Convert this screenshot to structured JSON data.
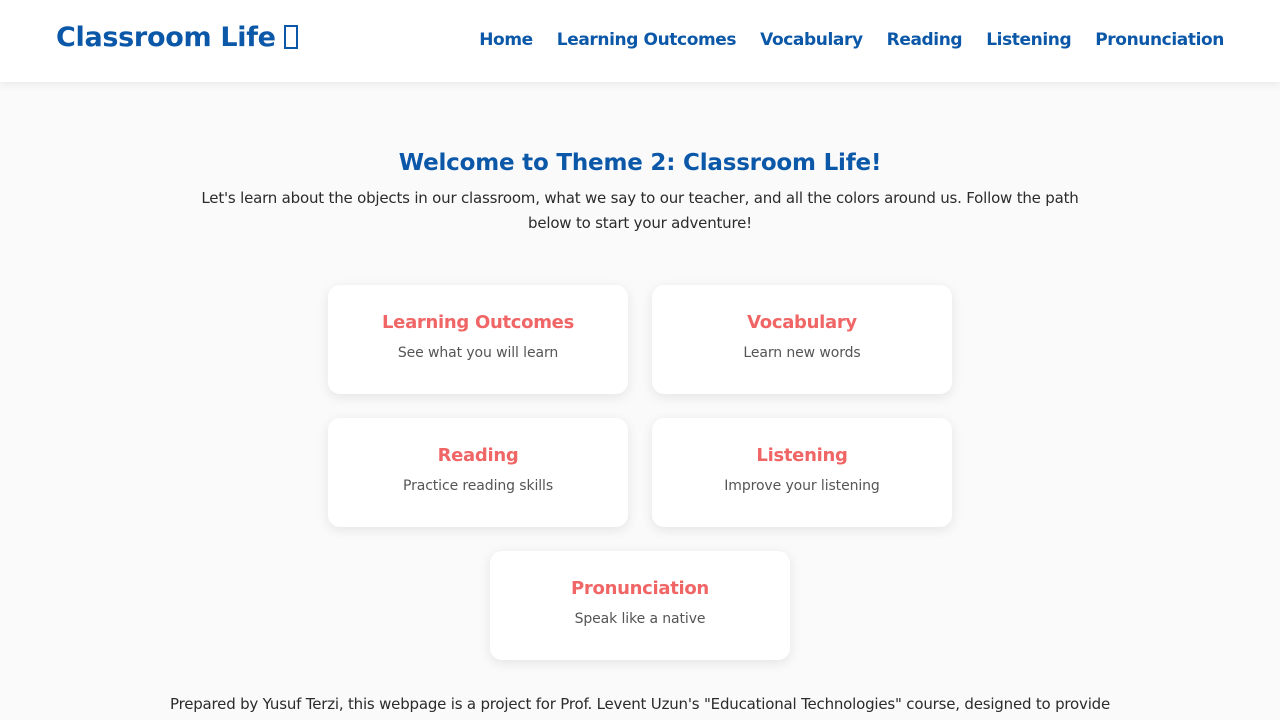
{
  "header": {
    "logo_text": "Classroom Life",
    "logo_icon": "missing-glyph-box-icon",
    "nav": [
      {
        "label": "Home"
      },
      {
        "label": "Learning Outcomes"
      },
      {
        "label": "Vocabulary"
      },
      {
        "label": "Reading"
      },
      {
        "label": "Listening"
      },
      {
        "label": "Pronunciation"
      }
    ]
  },
  "hero": {
    "title": "Welcome to Theme 2: Classroom Life!",
    "text": "Let's learn about the objects in our classroom, what we say to our teacher, and all the colors around us. Follow the path below to start your adventure!"
  },
  "cards": [
    {
      "title": "Learning Outcomes",
      "desc": "See what you will learn"
    },
    {
      "title": "Vocabulary",
      "desc": "Learn new words"
    },
    {
      "title": "Reading",
      "desc": "Practice reading skills"
    },
    {
      "title": "Listening",
      "desc": "Improve your listening"
    },
    {
      "title": "Pronunciation",
      "desc": "Speak like a native"
    }
  ],
  "footer": {
    "text": "Prepared by Yusuf Terzi, this webpage is a project for Prof. Levent Uzun's \"Educational Technologies\" course, designed to provide"
  },
  "colors": {
    "brand": "#0b57a8",
    "card_title": "#f06565",
    "background": "#fafafa"
  }
}
